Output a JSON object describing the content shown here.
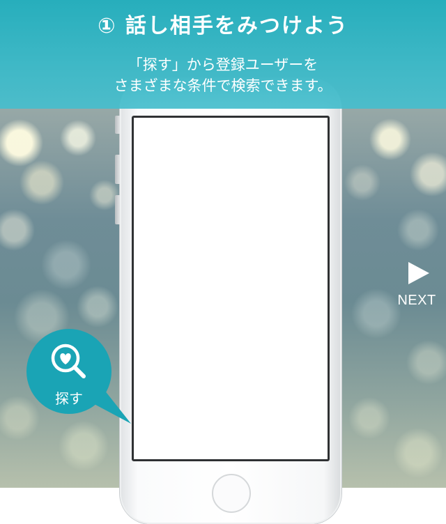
{
  "banner": {
    "title": "① 話し相手をみつけよう",
    "desc_line1": "「探す」から登録ユーザーを",
    "desc_line2": "さまざまな条件で検索できます。"
  },
  "next": {
    "label": "NEXT",
    "icon": "play-arrow-icon"
  },
  "search_badge": {
    "label": "探す",
    "icon": "heart-search-icon"
  },
  "colors": {
    "accent": "#2bb0bf",
    "banner": "#3fb8c6",
    "badge": "#1aa4b5",
    "text_on_accent": "#ffffff"
  }
}
